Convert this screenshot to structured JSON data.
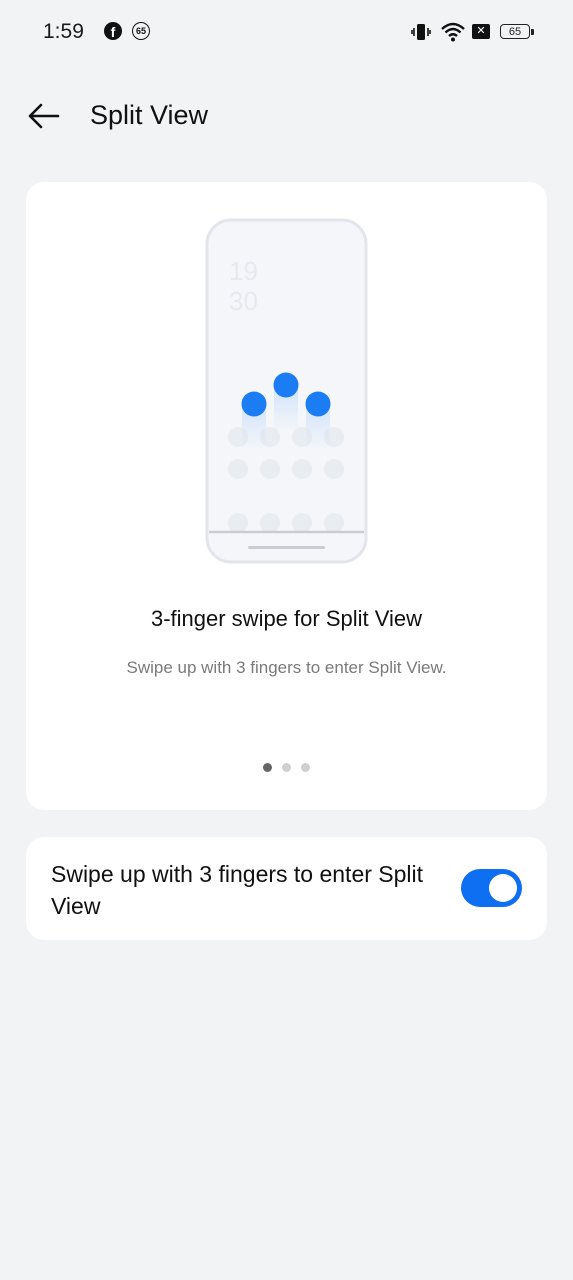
{
  "status_bar": {
    "time": "1:59",
    "notification_badge": "65",
    "battery_level": "65",
    "icons": [
      "facebook-icon",
      "notification-badge-icon",
      "vibrate-icon",
      "wifi-icon",
      "x-icon",
      "battery-icon"
    ]
  },
  "header": {
    "title": "Split View",
    "back_icon": "arrow-left-icon"
  },
  "hero": {
    "illustration_clock": [
      "19",
      "30"
    ],
    "title": "3-finger swipe for Split View",
    "subtitle": "Swipe up with 3 fingers to enter Split View.",
    "page_count": 3,
    "active_page": 1
  },
  "setting": {
    "label": "Swipe up with 3 fingers to enter Split View",
    "enabled": true
  },
  "colors": {
    "accent": "#0f6ff2",
    "background": "#f2f3f5",
    "card": "#ffffff"
  }
}
